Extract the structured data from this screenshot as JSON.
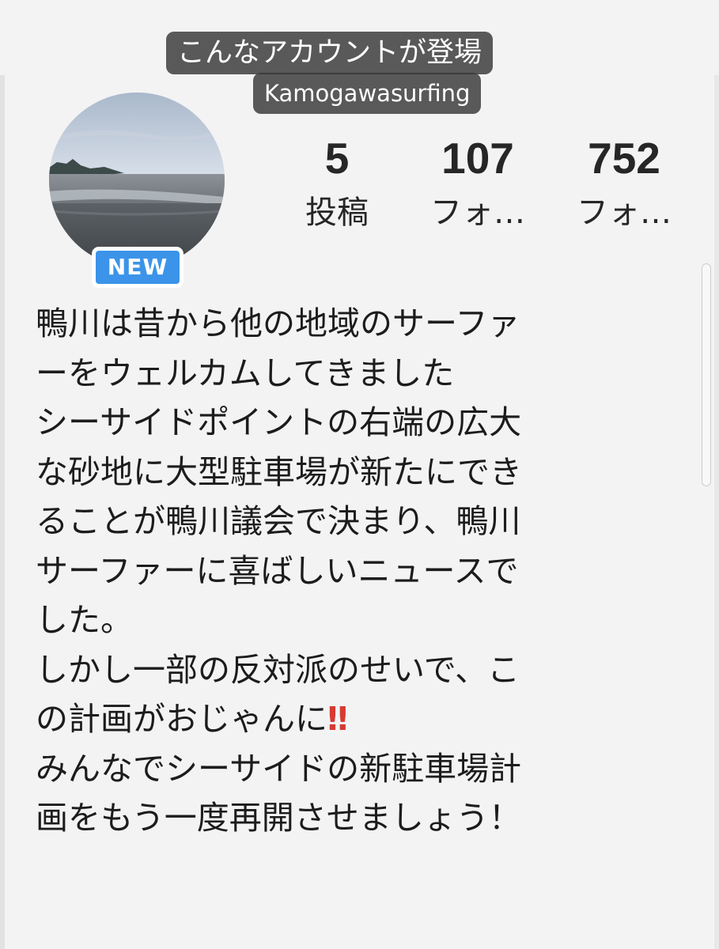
{
  "caption": {
    "title": "こんなアカウントが登場",
    "account": "Kamogawasurfing"
  },
  "profile": {
    "badge": "NEW",
    "avatar_icon": "beach-photo-avatar",
    "stats": [
      {
        "value": "5",
        "label": "投稿"
      },
      {
        "value": "107",
        "label": "フォ…"
      },
      {
        "value": "752",
        "label": "フォ…"
      }
    ]
  },
  "bio": {
    "lines": [
      "鴨川は昔から他の地域のサーファ",
      "ーをウェルカムしてきました",
      "シーサイドポイントの右端の広大",
      "な砂地に大型駐車場が新たにでき",
      "ることが鴨川議会で決まり、鴨川",
      "サーファーに喜ばしいニュースで",
      "した。",
      "しかし一部の反対派のせいで、こ",
      "の計画がおじゃんに",
      "みんなでシーサイドの新駐車場計",
      "画をもう一度再開させましょう！"
    ],
    "emoji": "‼",
    "emoji_icon": "double-exclamation-icon"
  },
  "colors": {
    "badge": "#3b94e9",
    "emoji": "#d63a32",
    "caption_bg": "#373737"
  }
}
